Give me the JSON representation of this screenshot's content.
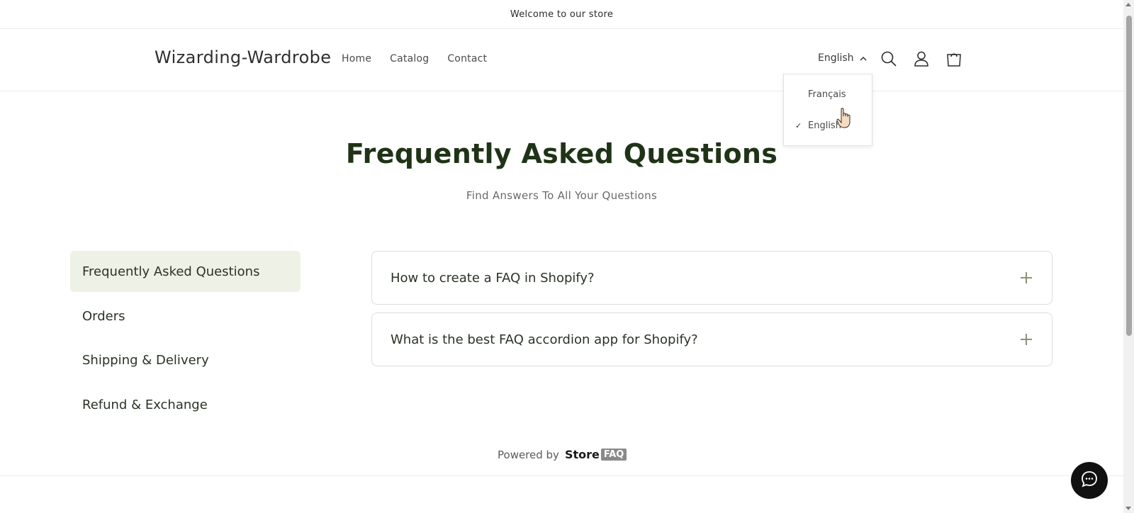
{
  "announcement": "Welcome to our store",
  "header": {
    "logo": "Wizarding-Wardrobe",
    "nav": [
      "Home",
      "Catalog",
      "Contact"
    ],
    "language_current": "English",
    "icons": [
      "search-icon",
      "account-icon",
      "cart-icon"
    ]
  },
  "language_menu": {
    "items": [
      {
        "label": "Français",
        "selected": false
      },
      {
        "label": "English",
        "selected": true
      }
    ]
  },
  "faq": {
    "title": "Frequently Asked Questions",
    "subtitle": "Find Answers To All Your Questions",
    "categories": [
      {
        "label": "Frequently Asked Questions",
        "active": true
      },
      {
        "label": "Orders",
        "active": false
      },
      {
        "label": "Shipping & Delivery",
        "active": false
      },
      {
        "label": "Refund & Exchange",
        "active": false
      }
    ],
    "questions": [
      {
        "question": "How to create a FAQ in Shopify?"
      },
      {
        "question": "What is the best FAQ accordion app for Shopify?"
      }
    ]
  },
  "footer": {
    "powered_by": "Powered by",
    "brand_store": "Store",
    "brand_faq": "FAQ"
  },
  "colors": {
    "accent_bg": "#eef1e6",
    "title": "#1f3316",
    "chat_button": "#111111"
  }
}
